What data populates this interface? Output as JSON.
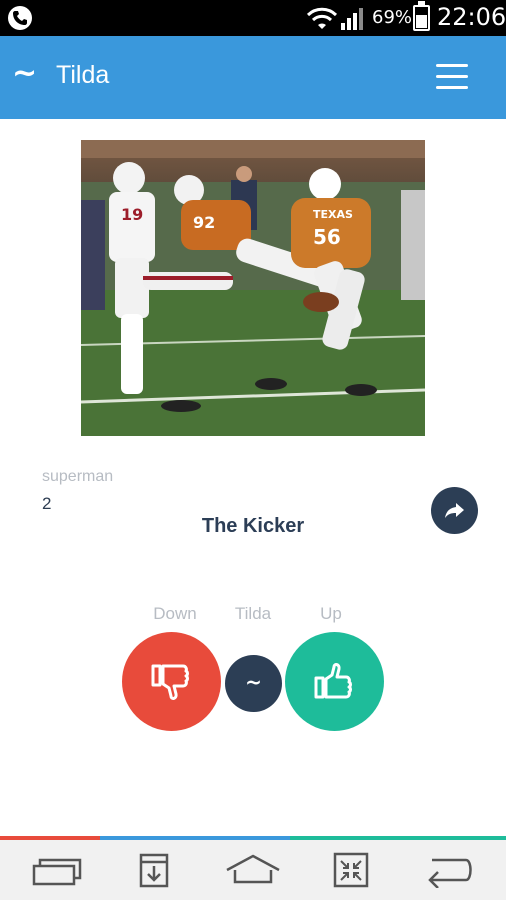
{
  "status_bar": {
    "battery": "69%",
    "time": "22:06"
  },
  "app_bar": {
    "logo": "~",
    "title": "Tilda"
  },
  "post": {
    "author": "superman",
    "score": "2",
    "title": "The Kicker"
  },
  "vote": {
    "down_label": "Down",
    "tilda_label": "Tilda",
    "up_label": "Up",
    "tilda_button": "~"
  },
  "colors": {
    "app_bar": "#3a98dc",
    "down": "#e84b3b",
    "up": "#1ebc9a",
    "dark": "#2c3e55"
  },
  "icons": {
    "share": "share-arrow-icon",
    "down": "thumbs-down-icon",
    "up": "thumbs-up-icon"
  }
}
